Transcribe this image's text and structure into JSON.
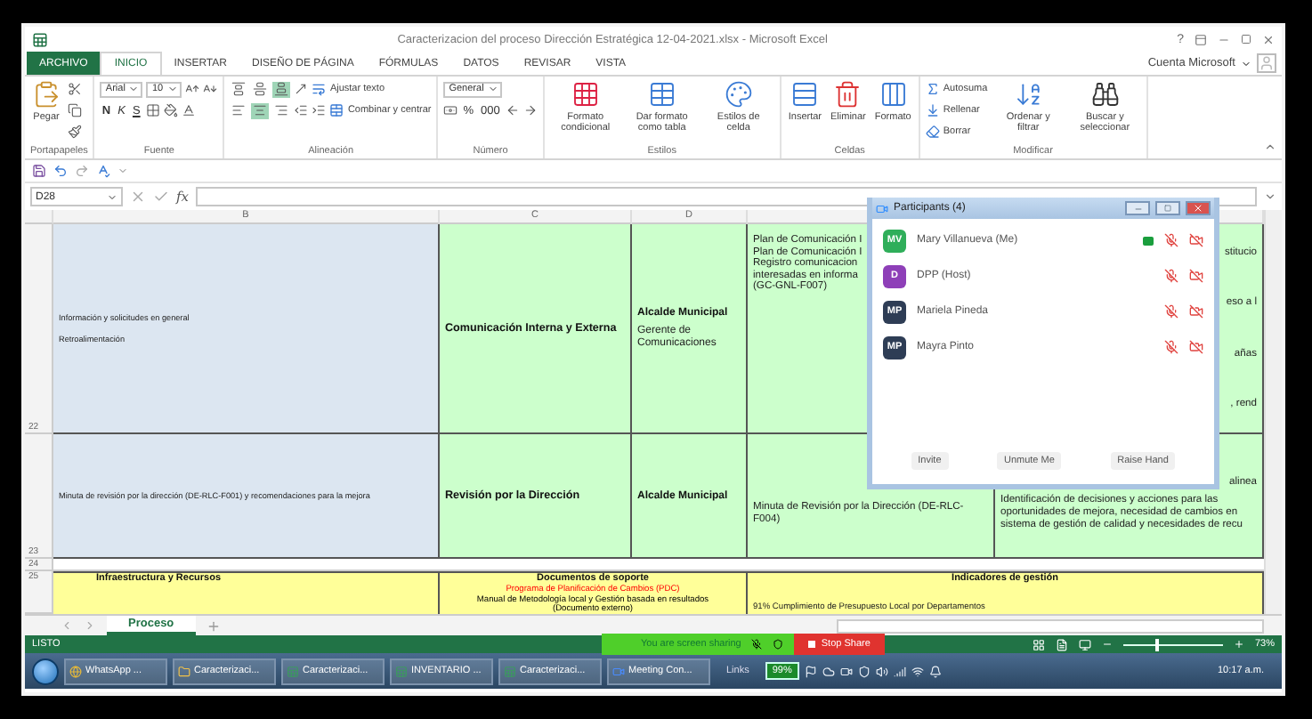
{
  "window": {
    "title": "Caracterizacion del proceso Dirección Estratégica 12-04-2021.xlsx - Microsoft Excel",
    "help": "?",
    "account": "Cuenta Microsoft"
  },
  "ribbon_tabs": [
    {
      "label": "ARCHIVO",
      "kind": "file",
      "selected": false
    },
    {
      "label": "INICIO",
      "kind": "tab",
      "selected": true
    },
    {
      "label": "INSERTAR",
      "kind": "tab",
      "selected": false
    },
    {
      "label": "DISEÑO DE PÁGINA",
      "kind": "tab",
      "selected": false
    },
    {
      "label": "FÓRMULAS",
      "kind": "tab",
      "selected": false
    },
    {
      "label": "DATOS",
      "kind": "tab",
      "selected": false
    },
    {
      "label": "REVISAR",
      "kind": "tab",
      "selected": false
    },
    {
      "label": "VISTA",
      "kind": "tab",
      "selected": false
    }
  ],
  "ribbon_groups": [
    {
      "label": "Portapapeles",
      "stacks": [
        {
          "kind": "large",
          "label": "Pegar"
        },
        {
          "kind": "lines",
          "lines": [
            {
              "items": [
                {
                  "kind": "icon"
                }
              ]
            },
            {
              "items": [
                {
                  "kind": "icon"
                }
              ]
            },
            {
              "items": [
                {
                  "kind": "icon"
                }
              ]
            }
          ]
        }
      ]
    },
    {
      "label": "Fuente",
      "stacks": [
        {
          "kind": "lines",
          "lines": [
            {
              "items": [
                {
                  "kind": "field",
                  "value": "Arial"
                },
                {
                  "kind": "field",
                  "value": "10"
                },
                {
                  "kind": "icon"
                },
                {
                  "kind": "icon"
                }
              ]
            },
            {
              "items": [
                {
                  "kind": "bold",
                  "label": "N"
                },
                {
                  "kind": "italic",
                  "label": "K"
                },
                {
                  "kind": "underline",
                  "label": "S"
                },
                {
                  "kind": "icon"
                },
                {
                  "kind": "icon"
                },
                {
                  "kind": "icon"
                }
              ]
            }
          ]
        }
      ]
    },
    {
      "label": "Alineación",
      "stacks": [
        {
          "kind": "lines",
          "lines": [
            {
              "items": [
                {
                  "kind": "toggle",
                  "on": false
                },
                {
                  "kind": "toggle",
                  "on": false
                },
                {
                  "kind": "toggle",
                  "on": true
                },
                {
                  "kind": "icon"
                },
                {
                  "kind": "labeled",
                  "label": "Ajustar texto"
                }
              ]
            },
            {
              "items": [
                {
                  "kind": "toggle",
                  "on": false
                },
                {
                  "kind": "toggle",
                  "on": true
                },
                {
                  "kind": "toggle",
                  "on": false
                },
                {
                  "kind": "icon"
                },
                {
                  "kind": "icon"
                },
                {
                  "kind": "labeled",
                  "label": "Combinar y centrar"
                }
              ]
            }
          ]
        }
      ]
    },
    {
      "label": "Número",
      "stacks": [
        {
          "kind": "lines",
          "lines": [
            {
              "items": [
                {
                  "kind": "field",
                  "value": "General"
                }
              ]
            },
            {
              "items": [
                {
                  "kind": "icon"
                },
                {
                  "kind": "text",
                  "label": "%"
                },
                {
                  "kind": "text",
                  "label": "000"
                },
                {
                  "kind": "icon"
                },
                {
                  "kind": "icon"
                }
              ]
            }
          ]
        }
      ]
    },
    {
      "label": "Estilos",
      "stacks": [
        {
          "kind": "large",
          "label": "Formato condicional"
        },
        {
          "kind": "large",
          "label": "Dar formato como tabla"
        },
        {
          "kind": "large",
          "label": "Estilos de celda"
        }
      ]
    },
    {
      "label": "Celdas",
      "stacks": [
        {
          "kind": "large",
          "label": "Insertar"
        },
        {
          "kind": "large",
          "label": "Eliminar"
        },
        {
          "kind": "large",
          "label": "Formato"
        }
      ]
    },
    {
      "label": "Modificar",
      "stacks": [
        {
          "kind": "lines",
          "lines": [
            {
              "items": [
                {
                  "kind": "labeled",
                  "label": "Autosuma"
                }
              ]
            },
            {
              "items": [
                {
                  "kind": "labeled",
                  "label": "Rellenar"
                }
              ]
            },
            {
              "items": [
                {
                  "kind": "labeled",
                  "label": "Borrar"
                }
              ]
            }
          ]
        },
        {
          "kind": "large",
          "label": "Ordenar y filtrar"
        },
        {
          "kind": "large",
          "label": "Buscar y seleccionar"
        }
      ]
    }
  ],
  "formula_bar": {
    "name_box": "D28",
    "function_label": "fx"
  },
  "column_headers": [
    "B",
    "C",
    "D"
  ],
  "rows": [
    {
      "number": "22",
      "cells": [
        {
          "kind": "info",
          "lines": [
            "Información y solicitudes en general",
            "Retroalimentación"
          ]
        },
        {
          "kind": "process",
          "text": "Comunicación Interna y Externa"
        },
        {
          "kind": "owner",
          "title": "Alcalde Municipal",
          "subtitle": "Gerente de Comunicaciones"
        },
        {
          "kind": "doc",
          "lines": [
            "Plan de Comunicación I",
            "Plan de Comunicación I",
            " Registro comunicacion",
            "interesadas en informa",
            "(GC-GNL-F007)"
          ]
        },
        {
          "kind": "fragments",
          "lines": [
            "stitucio",
            "eso a l",
            "añas",
            ", rend"
          ]
        }
      ]
    },
    {
      "number": "23",
      "cells": [
        {
          "kind": "info",
          "lines": [
            "Minuta de revisión por la dirección (DE-RLC-F001) y recomendaciones para la mejora"
          ]
        },
        {
          "kind": "process",
          "text": "Revisión por la Dirección"
        },
        {
          "kind": "owner",
          "title": "Alcalde Municipal"
        },
        {
          "kind": "doc",
          "lines": [
            "Minuta de Revisión por la Dirección (DE-RLC-",
            "F004)"
          ]
        },
        {
          "kind": "detail",
          "tail": "alinea",
          "text": "Identificación de decisiones y acciones para las oportunidades de mejora, necesidad de cambios en sistema de gestión de calidad y necesidades de recu"
        }
      ]
    }
  ],
  "spacer_row": "24",
  "section_row": {
    "number": "25",
    "title": "Infraestructura y Recursos",
    "documents": {
      "heading": "Documentos de soporte",
      "lines": [
        {
          "text": "Programa de Planificación de Cambios (PDC)",
          "kind": "alert"
        },
        {
          "text": "Manual de Metodología local y Gestión basada en resultados",
          "kind": "normal"
        },
        {
          "text": "(Documento externo)",
          "kind": "normal"
        }
      ]
    },
    "indicators": {
      "heading": "Indicadores de gestión",
      "text": "91% Cumplimiento de Presupuesto Local por Departamentos"
    }
  },
  "sheet_tabs": [
    {
      "label": "Proceso",
      "selected": true
    }
  ],
  "status_bar": {
    "state": "LISTO",
    "zoom": "73%",
    "zoom_level": {
      "level": 0.33
    }
  },
  "share_bar": {
    "message": "You are screen sharing",
    "stop": "Stop Share"
  },
  "participants": {
    "title": "Participants (4)",
    "people": [
      {
        "initials": "MV",
        "name": "Mary Villanueva (Me)",
        "color": "#2fae5a",
        "sharing": true
      },
      {
        "initials": "D",
        "name": "DPP (Host)",
        "color": "#8e3fb8",
        "sharing": false
      },
      {
        "initials": "MP",
        "name": "Mariela Pineda",
        "color": "#2e3d55",
        "sharing": false
      },
      {
        "initials": "MP",
        "name": "Mayra Pinto",
        "color": "#2e3d55",
        "sharing": false
      }
    ],
    "buttons": [
      "Invite",
      "Unmute Me",
      "Raise Hand"
    ]
  },
  "taskbar": {
    "items": [
      {
        "kind": "browser",
        "label": "WhatsApp ..."
      },
      {
        "kind": "folder",
        "label": "Caracterizaci..."
      },
      {
        "kind": "excel",
        "label": "Caracterizaci..."
      },
      {
        "kind": "excel",
        "label": "INVENTARIO ..."
      },
      {
        "kind": "excel",
        "label": "Caracterizaci..."
      },
      {
        "kind": "meeting",
        "label": "Meeting Con..."
      }
    ],
    "links": "Links",
    "battery": "99%",
    "clock": "10:17 a.m."
  }
}
